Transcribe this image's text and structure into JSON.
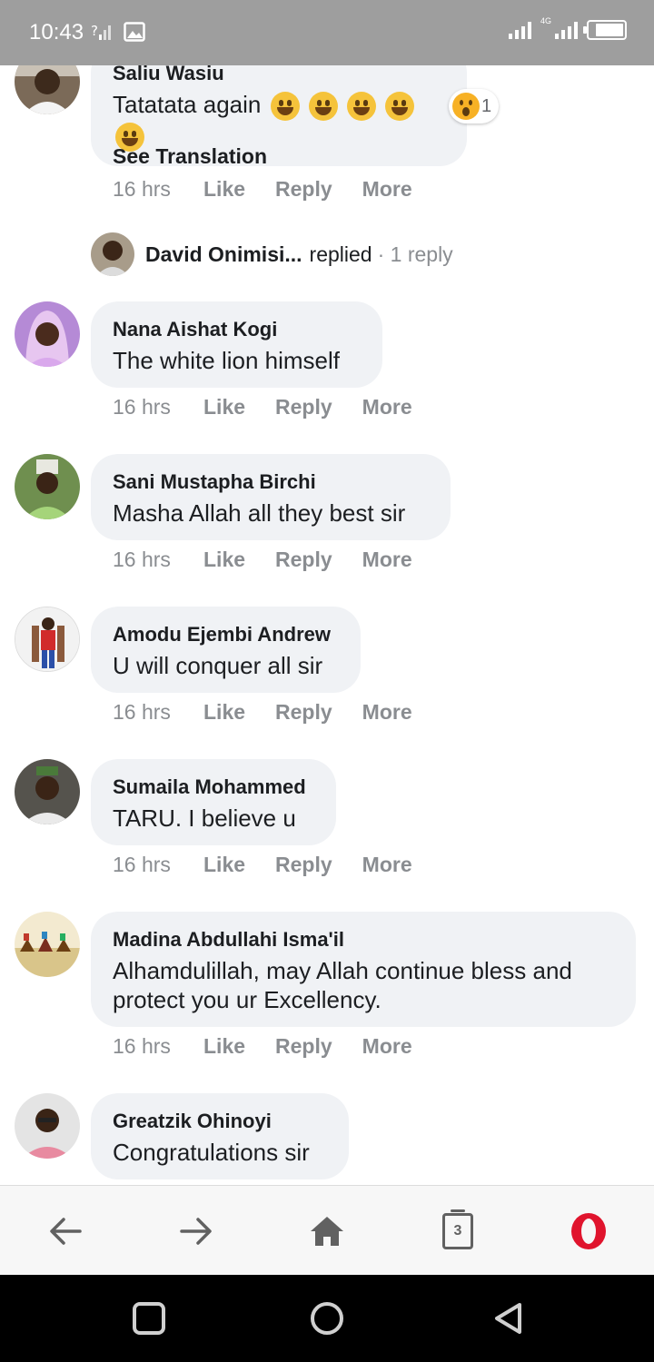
{
  "status_bar": {
    "time": "10:43",
    "network_label": "4G"
  },
  "thread": {
    "top_comment": {
      "name": "Saliu Wasiu",
      "text": "Tatatata again",
      "reaction_count": "1",
      "see_translation": "See Translation",
      "time": "16 hrs",
      "like": "Like",
      "reply": "Reply",
      "more": "More"
    },
    "replied_row": {
      "name": "David Onimisi...",
      "action": "replied",
      "count": "· 1 reply"
    },
    "comments": [
      {
        "name": "Nana Aishat Kogi",
        "text": "The white lion himself",
        "time": "16 hrs",
        "like": "Like",
        "reply": "Reply",
        "more": "More"
      },
      {
        "name": "Sani Mustapha Birchi",
        "text": "Masha Allah all they best sir",
        "time": "16 hrs",
        "like": "Like",
        "reply": "Reply",
        "more": "More"
      },
      {
        "name": "Amodu Ejembi Andrew",
        "text": "U will conquer all sir",
        "time": "16 hrs",
        "like": "Like",
        "reply": "Reply",
        "more": "More"
      },
      {
        "name": "Sumaila Mohammed",
        "text": "TARU. I believe u",
        "time": "16 hrs",
        "like": "Like",
        "reply": "Reply",
        "more": "More"
      },
      {
        "name": "Madina Abdullahi Isma'il",
        "text": "Alhamdulillah, may Allah continue bless and protect you ur Excellency.",
        "time": "16 hrs",
        "like": "Like",
        "reply": "Reply",
        "more": "More"
      },
      {
        "name": "Greatzik Ohinoyi",
        "text": "Congratulations sir"
      }
    ]
  },
  "browser_bar": {
    "tab_count": "3",
    "icons": [
      "back-arrow-icon",
      "forward-arrow-icon",
      "home-icon",
      "tabs-icon",
      "opera-menu-icon"
    ]
  },
  "nav_bar": {
    "icons": [
      "recents-icon",
      "home-circle-icon",
      "back-triangle-icon"
    ]
  },
  "colors": {
    "bubble_bg": "#f0f2f5",
    "meta_text": "#8a8d91",
    "status_bar_bg": "#9e9e9e",
    "opera_red": "#e0142d"
  }
}
